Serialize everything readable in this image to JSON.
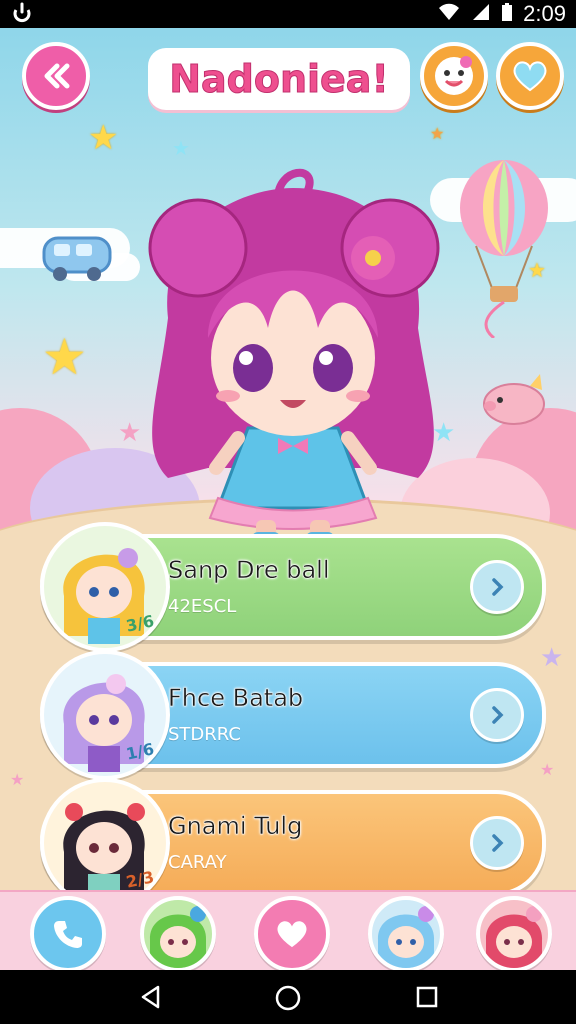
{
  "status_bar": {
    "time": "2:09"
  },
  "header": {
    "title": "Nadoniea!"
  },
  "colors": {
    "accent_pink": "#ef5ea8",
    "accent_orange": "#f6a63a",
    "card_green": "#8fd27a",
    "card_blue": "#6cc1ec",
    "card_orange": "#f5ac58",
    "tabbar_bg": "#f9d1df"
  },
  "cards": [
    {
      "title": "Sanp Dre ball",
      "subtitle": "42ESCL",
      "badge": "3/6"
    },
    {
      "title": "Fhce Batab",
      "subtitle": "STDRRC",
      "badge": "1/6"
    },
    {
      "title": "Gnami Tulg",
      "subtitle": "CARAY",
      "badge": "2/3"
    }
  ],
  "tabs": [
    {
      "icon": "phone-icon"
    },
    {
      "icon": "green-hair-character-avatar"
    },
    {
      "icon": "heart-icon"
    },
    {
      "icon": "blue-hair-character-avatar"
    },
    {
      "icon": "red-hair-character-avatar"
    }
  ],
  "nav": [
    {
      "icon": "back-triangle-icon"
    },
    {
      "icon": "home-circle-icon"
    },
    {
      "icon": "recents-square-icon"
    }
  ]
}
